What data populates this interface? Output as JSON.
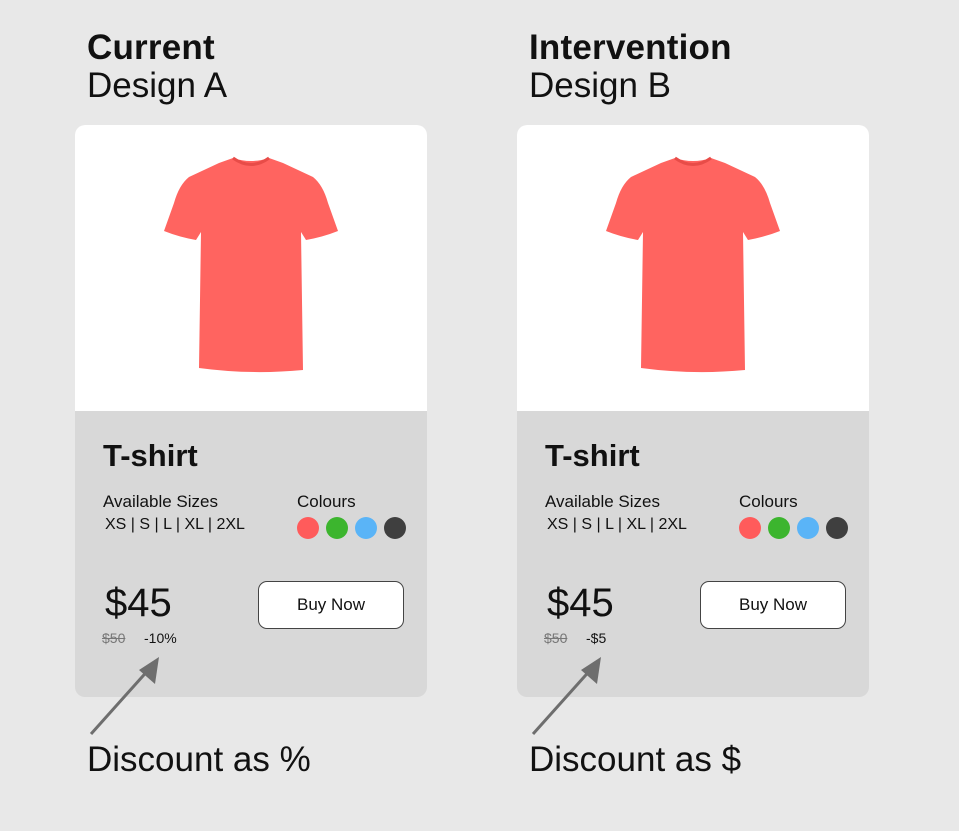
{
  "designs": [
    {
      "heading": "Current",
      "subheading": "Design A",
      "product_title": "T-shirt",
      "sizes_label": "Available Sizes",
      "sizes": "XS | S | L | XL | 2XL",
      "colours_label": "Colours",
      "colours": [
        "#ff5b5b",
        "#3cb52e",
        "#5ab4f7",
        "#3f3f3f"
      ],
      "price": "$45",
      "old_price": "$50",
      "discount": "-10%",
      "buy_label": "Buy Now",
      "caption": "Discount as %"
    },
    {
      "heading": "Intervention",
      "subheading": "Design B",
      "product_title": "T-shirt",
      "sizes_label": "Available Sizes",
      "sizes": "XS | S | L | XL | 2XL",
      "colours_label": "Colours",
      "colours": [
        "#ff5b5b",
        "#3cb52e",
        "#5ab4f7",
        "#3f3f3f"
      ],
      "price": "$45",
      "old_price": "$50",
      "discount": "-$5",
      "buy_label": "Buy Now",
      "caption": "Discount as $"
    }
  ],
  "tshirt_color": "#ff6460",
  "arrow_color": "#6e6e6e"
}
